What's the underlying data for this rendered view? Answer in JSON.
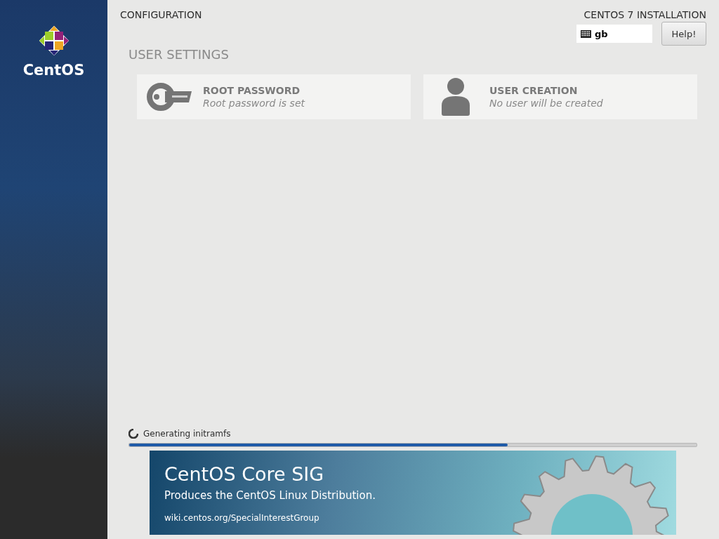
{
  "sidebar": {
    "logo_text": "CentOS"
  },
  "header": {
    "title": "CONFIGURATION",
    "product": "CENTOS 7 INSTALLATION",
    "keyboard_layout": "gb",
    "help_button": "Help!"
  },
  "section": {
    "title": "USER SETTINGS"
  },
  "spokes": [
    {
      "kind": "key",
      "title": "ROOT PASSWORD",
      "status": "Root password is set"
    },
    {
      "kind": "user",
      "title": "USER CREATION",
      "status": "No user will be created"
    }
  ],
  "progress": {
    "status": "Generating initramfs",
    "level": 0.667
  },
  "banner": {
    "title": "CentOS Core SIG",
    "subtitle": "Produces the CentOS Linux Distribution.",
    "link": "wiki.centos.org/SpecialInterestGroup"
  }
}
